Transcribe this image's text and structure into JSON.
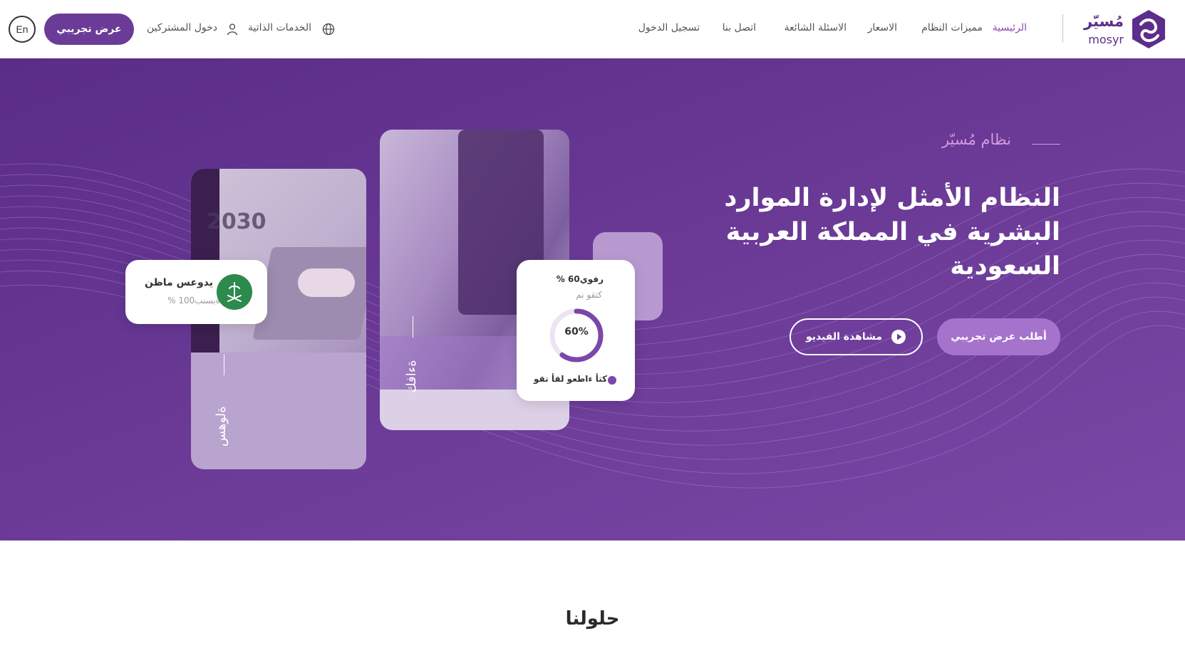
{
  "header": {
    "logo": {
      "ar": "مُسيّر",
      "en": "mosyr"
    },
    "nav": [
      {
        "label": "الرئيسية",
        "active": true
      },
      {
        "label": "مميزات النظام"
      },
      {
        "label": "الاسعار"
      },
      {
        "label": "الاسئلة الشائعة"
      },
      {
        "label": "اتصل بنا"
      },
      {
        "label": "تسجيل الدخول"
      }
    ],
    "self_services": "الخدمات الذاتية",
    "subscribers_login": "دخول المشتركين",
    "demo_button": "عرض تجريبي",
    "lang_button": "En",
    "icons": {
      "globe": "globe-icon",
      "user": "user-icon"
    }
  },
  "hero": {
    "eyebrow": "نظام مُسيّر",
    "title": "النظام الأمثل لإدارة الموارد البشرية في المملكة العربية السعودية",
    "request_demo": "أطلب عرض تجريبي",
    "watch_video": "مشاهدة الفيديو",
    "card_left_vertical": "ةلوهس",
    "card_mid_vertical": "ةءافك",
    "stat_card": {
      "line1": "% رفوي60",
      "line2": "كتقو نم",
      "percent": "60%",
      "progress": 0.6,
      "footer": "كتأ ءاطعو لقأ تقو"
    },
    "cert_card": {
      "line1": "يدوعس ماظن",
      "line2": "% ةبسنب100"
    }
  },
  "solutions": {
    "title": "حلولنا"
  },
  "colors": {
    "brand": "#5c2d8a",
    "accent": "#8a4bb5",
    "hero": "#6a3a96"
  }
}
